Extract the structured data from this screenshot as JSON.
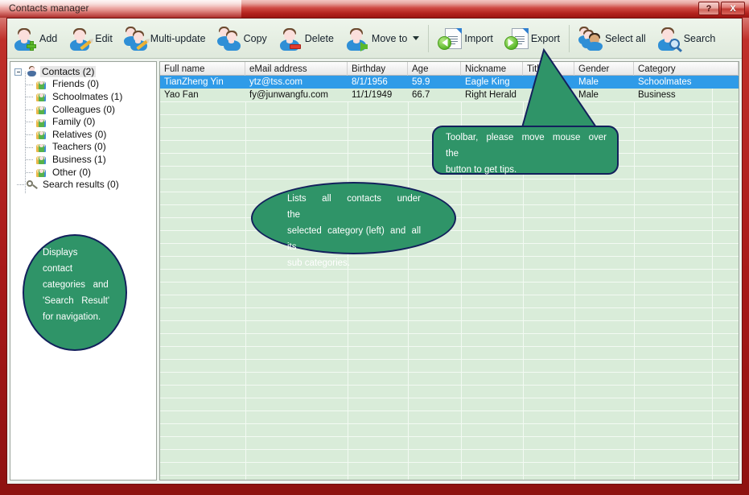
{
  "window": {
    "title": "Contacts manager",
    "help_button": "?",
    "close_button": "X"
  },
  "toolbar": {
    "buttons": [
      {
        "label": "Add",
        "icon": "person-add-icon"
      },
      {
        "label": "Edit",
        "icon": "person-edit-icon"
      },
      {
        "label": "Multi-update",
        "icon": "people-edit-icon"
      },
      {
        "label": "Copy",
        "icon": "people-copy-icon"
      },
      {
        "label": "Delete",
        "icon": "person-delete-icon"
      },
      {
        "label": "Move to",
        "icon": "person-move-icon",
        "has_caret": true
      },
      {
        "label": "Import",
        "icon": "import-document-icon"
      },
      {
        "label": "Export",
        "icon": "export-document-icon"
      },
      {
        "label": "Select all",
        "icon": "select-all-people-icon"
      },
      {
        "label": "Search",
        "icon": "person-search-icon"
      }
    ]
  },
  "sidebar": {
    "root": {
      "label": "Contacts (2)",
      "icon": "person-icon",
      "selected": true
    },
    "children": [
      {
        "label": "Friends (0)",
        "icon": "group-icon"
      },
      {
        "label": "Schoolmates (1)",
        "icon": "group-icon"
      },
      {
        "label": "Colleagues (0)",
        "icon": "group-icon"
      },
      {
        "label": "Family (0)",
        "icon": "group-icon"
      },
      {
        "label": "Relatives (0)",
        "icon": "group-icon"
      },
      {
        "label": "Teachers (0)",
        "icon": "group-icon"
      },
      {
        "label": "Business (1)",
        "icon": "group-icon"
      },
      {
        "label": "Other (0)",
        "icon": "group-icon"
      }
    ],
    "search_results": {
      "label": "Search results (0)",
      "icon": "key-icon"
    }
  },
  "table": {
    "columns": [
      {
        "key": "full_name",
        "label": "Full name"
      },
      {
        "key": "email",
        "label": "eMail address"
      },
      {
        "key": "birthday",
        "label": "Birthday"
      },
      {
        "key": "age",
        "label": "Age"
      },
      {
        "key": "nickname",
        "label": "Nickname"
      },
      {
        "key": "title",
        "label": "Title"
      },
      {
        "key": "gender",
        "label": "Gender"
      },
      {
        "key": "category",
        "label": "Category"
      }
    ],
    "rows": [
      {
        "full_name": "TianZheng Yin",
        "email": "ytz@tss.com",
        "birthday": "8/1/1956",
        "age": "59.9",
        "nickname": "Eagle King",
        "title": "",
        "gender": "Male",
        "category": "Schoolmates",
        "selected": true
      },
      {
        "full_name": "Yao Fan",
        "email": "fy@junwangfu.com",
        "birthday": "11/1/1949",
        "age": "66.7",
        "nickname": "Right Herald",
        "title": "",
        "gender": "Male",
        "category": "Business",
        "selected": false
      }
    ]
  },
  "callouts": {
    "toolbar_tip": "Toolbar,  please  move  mouse  over  the\nbutton to get tips.",
    "list_tip": "Lists    all    contacts    under    the\nselected  category (left)  and  all  its\nsub categories.",
    "sidebar_tip": "Displays\ncontact\ncategories   and\n'Search   Result'\nfor navigation."
  },
  "colors": {
    "frame": "#a81a18",
    "selection": "#2f9be8",
    "callout_fill": "#2f9468",
    "callout_border": "#13205c",
    "grid_background": "#d9ecd9"
  }
}
